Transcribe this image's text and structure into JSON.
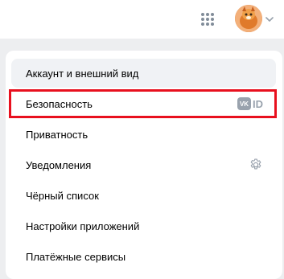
{
  "header": {
    "apps_icon": "grid-9-dots-icon",
    "avatar_icon": "user-avatar",
    "menu_chevron_icon": "chevron-down-icon"
  },
  "menu": {
    "items": [
      {
        "label": "Аккаунт и внешний вид"
      },
      {
        "label": "Безопасность",
        "badge": "ID",
        "badge_icon": "vk-logo-icon"
      },
      {
        "label": "Приватность"
      },
      {
        "label": "Уведомления",
        "icon": "gear-icon"
      },
      {
        "label": "Чёрный список"
      },
      {
        "label": "Настройки приложений"
      },
      {
        "label": "Платёжные сервисы"
      }
    ],
    "selected_index": 0,
    "highlighted_index": 1
  },
  "colors": {
    "page_bg": "#edeef0",
    "active_bg": "#f0f2f5",
    "highlight_border": "#e8101e",
    "icon_gray": "#99a2ad"
  }
}
